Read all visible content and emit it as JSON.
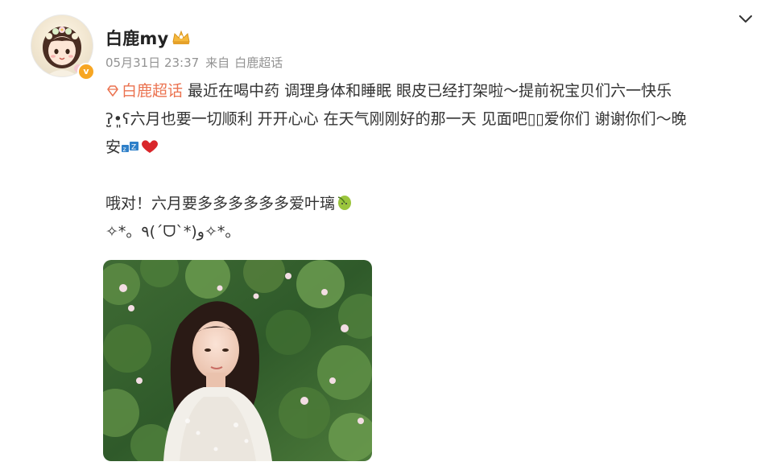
{
  "user": {
    "name": "白鹿my",
    "verified_badge": "v-badge-icon",
    "member_badge": "crown-icon"
  },
  "meta": {
    "timestamp": "05月31日 23:37",
    "source_label": "来自",
    "source_name": "白鹿超话"
  },
  "post": {
    "topic": "白鹿超话",
    "line1": " 最近在喝中药 调理身体和睡眠 眼皮已经打架啦～提前祝宝贝们六一快乐",
    "line2": "ʔ̤̮•͈ʕ六月也要一切顺利 开开心心 在天气刚刚好的那一天 见面吧▯▯爱你们 谢谢你们～晚",
    "line3": "安",
    "line4": "哦对！六月要多多多多多多爱叶璃",
    "line5": "✧*。٩(ˊᗜˋ*)و✧*。"
  },
  "colors": {
    "topic": "#eb7350",
    "meta": "#939393",
    "text": "#333333",
    "badge": "#f7a623"
  },
  "icons": {
    "more": "chevron-down-icon",
    "sleep": "sleep-emoji-icon",
    "heart": "red-heart-icon",
    "leaf": "green-leaf-emoji-icon",
    "topic": "diamond-topic-icon"
  }
}
